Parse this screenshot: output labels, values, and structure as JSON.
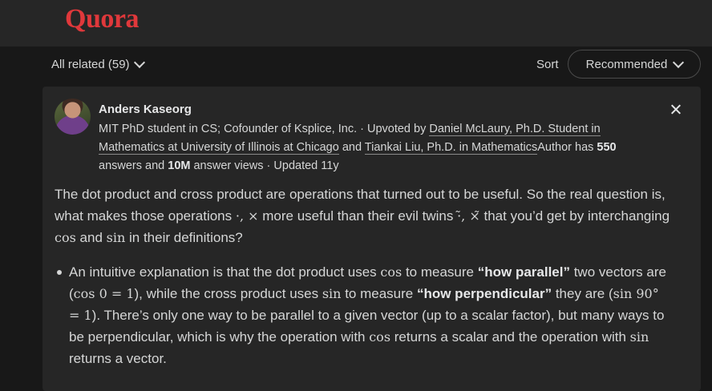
{
  "header": {
    "logo": "Quora"
  },
  "filters": {
    "all_related": "All related (59)",
    "sort_label": "Sort",
    "sort_value": "Recommended"
  },
  "answer": {
    "author": "Anders Kaseorg",
    "cred_1": "MIT PhD student in CS; Cofounder of Ksplice, Inc. · Upvoted by ",
    "upvoter_1": "Daniel McLaury, Ph.D. Student in Mathematics at University of Illinois at Chicago",
    "cred_and": " and ",
    "upvoter_2": "Tiankai Liu, Ph.D. in Mathematics",
    "cred_2": "Author has ",
    "answers_count": "550",
    "cred_3": " answers and ",
    "views_count": "10M",
    "cred_4": " answer views · Updated 11y",
    "p1_a": "The dot product and cross product are operations that turned out to be useful. So the real question is, what makes those operations ",
    "p1_ops": "·, ×",
    "p1_b": " more useful than their evil twins ",
    "p1_twins": "·̃, ×̃",
    "p1_c": " that you’d get by interchanging ",
    "cos": "cos",
    "p1_d": " and ",
    "sin": "sin",
    "p1_e": " in their definitions?",
    "b1_a": "An intuitive explanation is that the dot product uses ",
    "b1_b": " to measure ",
    "b1_parallel": "“how parallel”",
    "b1_c": " two vectors are (",
    "b1_eq1": "cos 0 = 1",
    "b1_d": "), while the cross product uses ",
    "b1_e": " to measure ",
    "b1_perp": "“how perpendicular”",
    "b1_f": " they are (",
    "b1_eq2": "sin 90° = 1",
    "b1_g": "). There’s only one way to be parallel to a given vector (up to a scalar factor), but many ways to be perpendicular, which is why the operation with ",
    "b1_h": " returns a scalar and the operation with ",
    "b1_i": " returns a vector."
  }
}
